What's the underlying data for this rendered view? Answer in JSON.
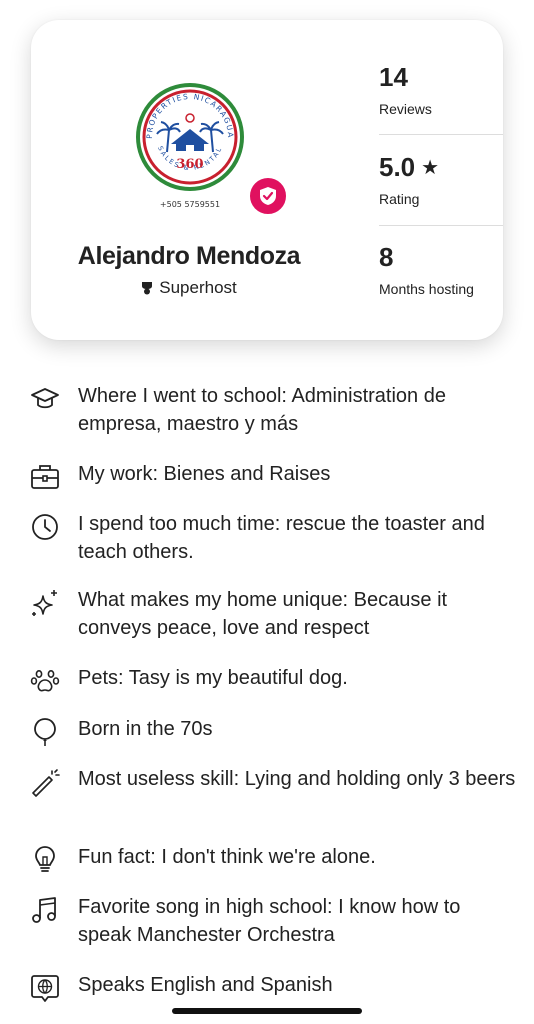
{
  "host": {
    "name": "Alejandro Mendoza",
    "badge": "Superhost",
    "logo": {
      "arc_top": "PROPERTIES NICARAGUA",
      "arc_bottom": "SALES & RENTAL",
      "number": "360",
      "phone": "+505 5759551"
    },
    "stats": [
      {
        "value": "14",
        "label": "Reviews"
      },
      {
        "value": "5.0",
        "label": "Rating",
        "icon": "star-icon"
      },
      {
        "value": "8",
        "label": "Months hosting"
      }
    ]
  },
  "about": [
    {
      "icon": "graduation-cap-icon",
      "text": "Where I went to school: Administration de empresa, maestro y más"
    },
    {
      "icon": "briefcase-icon",
      "text": "My work: Bienes and Raises"
    },
    {
      "icon": "clock-icon",
      "text": "I spend too much time: rescue the toaster and teach others."
    },
    {
      "icon": "sparkles-icon",
      "text": "What makes my home unique: Because it conveys peace, love and respect"
    },
    {
      "icon": "paw-icon",
      "text": "Pets: Tasy is my beautiful dog."
    },
    {
      "icon": "balloon-icon",
      "text": "Born in the 70s"
    },
    {
      "icon": "magic-wand-icon",
      "text": "Most useless skill: Lying and holding only 3 beers"
    },
    {
      "icon": "lightbulb-icon",
      "text": "Fun fact: I don't think we're alone."
    },
    {
      "icon": "music-note-icon",
      "text": "Favorite song in high school: I know how to speak Manchester Orchestra"
    },
    {
      "icon": "globe-chat-icon",
      "text": "Speaks English and Spanish"
    }
  ],
  "colors": {
    "verified_badge": "#e0115f",
    "logo_green": "#2e8b3a",
    "logo_red": "#c8202e",
    "logo_blue": "#1f4fa0"
  }
}
